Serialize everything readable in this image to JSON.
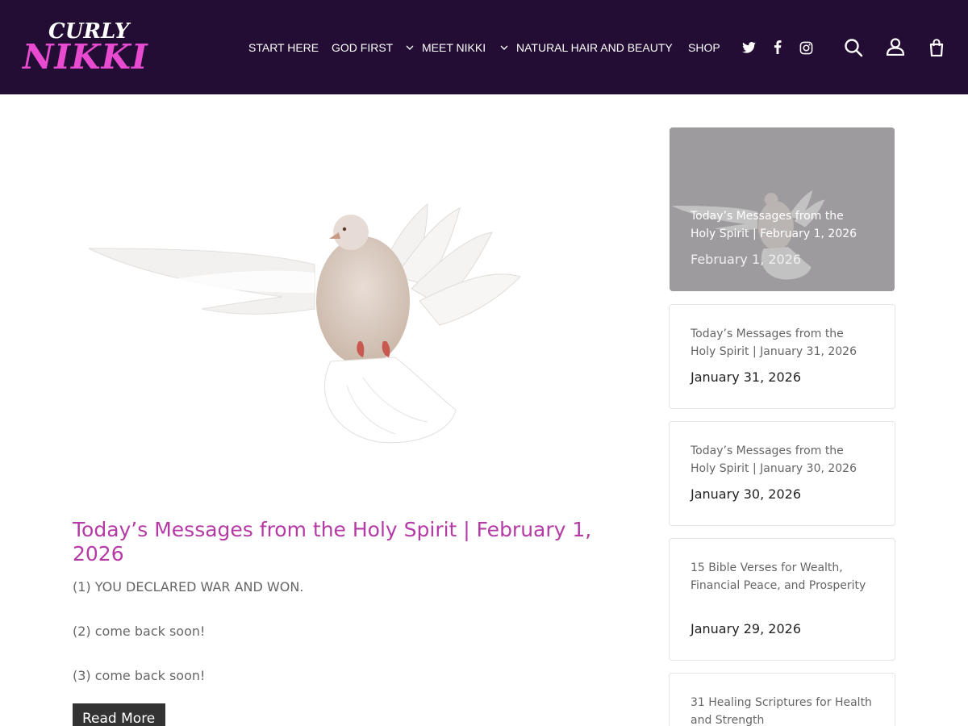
{
  "logo": {
    "line1": "CURLY",
    "line2": "NIKKI"
  },
  "nav": {
    "items": [
      {
        "label": "START HERE",
        "has_dropdown": false
      },
      {
        "label": "GOD FIRST",
        "has_dropdown": false
      },
      {
        "label": "MEET NIKKI",
        "has_dropdown": true
      },
      {
        "label": "NATURAL HAIR AND BEAUTY",
        "has_dropdown": true
      },
      {
        "label": "SHOP",
        "has_dropdown": false
      }
    ]
  },
  "header_icons": [
    "twitter-icon",
    "facebook-icon",
    "instagram-icon",
    "search-icon",
    "account-icon",
    "shopping-bag-icon"
  ],
  "main_post": {
    "title": "Today’s Messages from the Holy Spirit | February 1, 2026",
    "excerpt": [
      "(1) YOU DECLARED WAR AND WON.",
      "(2) come back soon!",
      "(3) come back soon!"
    ],
    "read_more": "Read More"
  },
  "sidebar": {
    "posts": [
      {
        "title": "Today’s Messages from the Holy Spirit | February 1, 2026",
        "date": "February 1, 2026",
        "featured": true
      },
      {
        "title": "Today’s Messages from the Holy Spirit | January 31, 2026",
        "date": "January 31, 2026",
        "featured": false
      },
      {
        "title": "Today’s Messages from the Holy Spirit | January 30, 2026",
        "date": "January 30, 2026",
        "featured": false
      },
      {
        "title": "15 Bible Verses for Wealth, Financial Peace, and Prosperity",
        "date": "January 29, 2026",
        "featured": false
      },
      {
        "title": "31 Healing Scriptures for Health and Strength",
        "date": "",
        "featured": false
      }
    ]
  },
  "colors": {
    "header_bg": "#230d34",
    "logo_accent": "#e84ad0",
    "title_accent": "#b53aa5",
    "button_bg": "#333333"
  }
}
